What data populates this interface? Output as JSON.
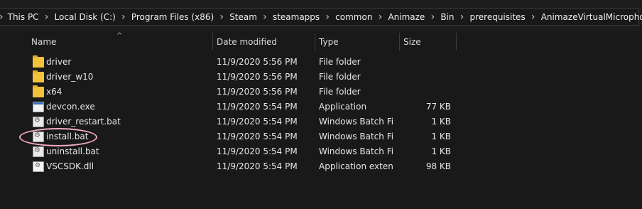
{
  "breadcrumb": [
    "This PC",
    "Local Disk (C:)",
    "Program Files (x86)",
    "Steam",
    "steamapps",
    "common",
    "Animaze",
    "Bin",
    "prerequisites",
    "AnimazeVirtualMicrophone"
  ],
  "columns": {
    "name": "Name",
    "date": "Date modified",
    "type": "Type",
    "size": "Size"
  },
  "files": [
    {
      "name": "driver",
      "date": "11/9/2020 5:56 PM",
      "type": "File folder",
      "size": "",
      "icon": "folder-icon"
    },
    {
      "name": "driver_w10",
      "date": "11/9/2020 5:56 PM",
      "type": "File folder",
      "size": "",
      "icon": "folder-icon"
    },
    {
      "name": "x64",
      "date": "11/9/2020 5:56 PM",
      "type": "File folder",
      "size": "",
      "icon": "folder-icon"
    },
    {
      "name": "devcon.exe",
      "date": "11/9/2020 5:54 PM",
      "type": "Application",
      "size": "77 KB",
      "icon": "application-icon"
    },
    {
      "name": "driver_restart.bat",
      "date": "11/9/2020 5:54 PM",
      "type": "Windows Batch File",
      "size": "1 KB",
      "icon": "batch-file-icon"
    },
    {
      "name": "install.bat",
      "date": "11/9/2020 5:54 PM",
      "type": "Windows Batch File",
      "size": "1 KB",
      "icon": "batch-file-icon"
    },
    {
      "name": "uninstall.bat",
      "date": "11/9/2020 5:54 PM",
      "type": "Windows Batch File",
      "size": "1 KB",
      "icon": "batch-file-icon"
    },
    {
      "name": "VSCSDK.dll",
      "date": "11/9/2020 5:54 PM",
      "type": "Application exten...",
      "size": "98 KB",
      "icon": "dll-file-icon"
    }
  ],
  "highlight_color": "#f3a9c8"
}
